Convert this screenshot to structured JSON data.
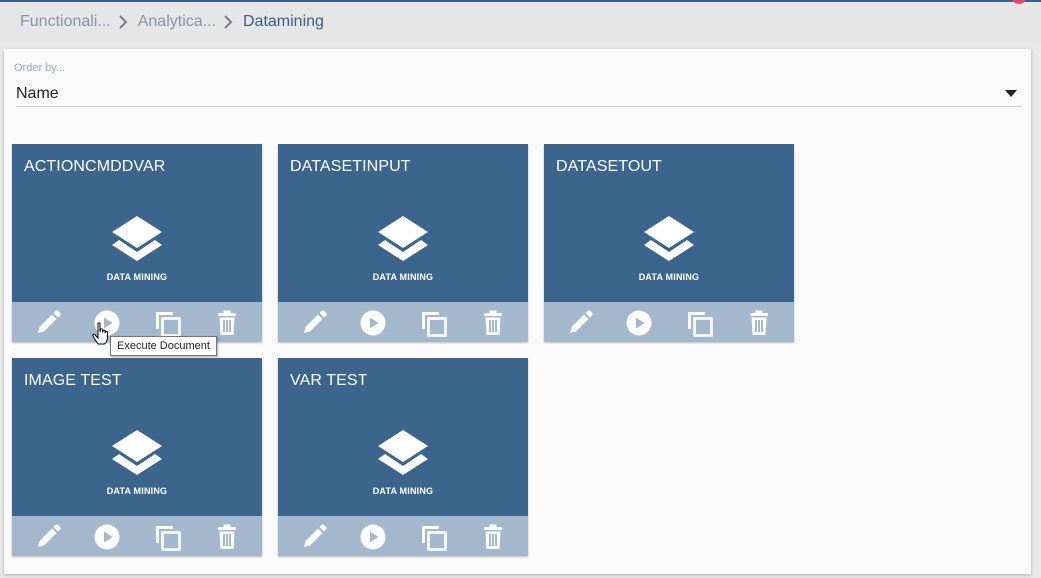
{
  "breadcrumb": {
    "items": [
      {
        "label": "Functionali..."
      },
      {
        "label": "Analytica..."
      },
      {
        "label": "Datamining"
      }
    ]
  },
  "order": {
    "label": "Order by...",
    "value": "Name"
  },
  "cards": [
    {
      "title": "ACTIONCMDDVAR",
      "subtitle": "DATA MINING"
    },
    {
      "title": "DATASETINPUT",
      "subtitle": "DATA MINING"
    },
    {
      "title": "DATASETOUT",
      "subtitle": "DATA MINING"
    },
    {
      "title": "IMAGE TEST",
      "subtitle": "DATA MINING"
    },
    {
      "title": "VAR TEST",
      "subtitle": "DATA MINING"
    }
  ],
  "card_actions": [
    "edit-icon",
    "execute-icon",
    "clone-icon",
    "delete-icon"
  ],
  "tooltip": {
    "text": "Execute Document"
  },
  "colors": {
    "card_bg": "#3b658d",
    "card_actions_bg": "#a3b8cc",
    "breadcrumb_link": "#8396ad",
    "breadcrumb_current": "#3b5f87"
  }
}
